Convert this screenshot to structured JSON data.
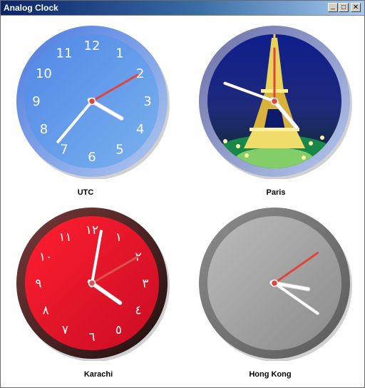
{
  "window": {
    "title": "Analog Clock",
    "buttons": {
      "minimize": "_",
      "maximize": "□",
      "close": "✕"
    }
  },
  "clocks": [
    {
      "city": "UTC",
      "face_style": "blue-gradient",
      "digits": [
        "12",
        "1",
        "2",
        "3",
        "4",
        "5",
        "6",
        "7",
        "8",
        "9",
        "10",
        "11"
      ],
      "colors": {
        "rim": "#4a7be0",
        "face_a": "#4f86e6",
        "face_b": "#7ab2ee",
        "digits": "#ffffff",
        "hands": "#ffffff",
        "second": "#e0443c"
      },
      "hands_angle": {
        "hour": 120,
        "minute": 220,
        "second": 60
      }
    },
    {
      "city": "Paris",
      "face_style": "eiffel-tower-night-photo",
      "digits": [],
      "colors": {
        "rim": "#6c6fa6",
        "face_a": "#0c1a6a",
        "face_b": "#17a54a",
        "hands": "#ffffff",
        "second": "#e0443c"
      },
      "hands_angle": {
        "hour": 140,
        "minute": 290,
        "second": 0
      }
    },
    {
      "city": "Karachi",
      "face_style": "red-arabic-numerals",
      "digits": [
        "١٢",
        "١",
        "٢",
        "٣",
        "٤",
        "٥",
        "٦",
        "٧",
        "٨",
        "٩",
        "١٠",
        "١١"
      ],
      "colors": {
        "rim": "#7a3a3a",
        "face_a": "#ff1f2f",
        "face_b": "#c90c24",
        "digits": "#ffffff",
        "hands": "#ffffff",
        "second": "#d9534f"
      },
      "hands_angle": {
        "hour": 125,
        "minute": 10,
        "second": 60
      }
    },
    {
      "city": "Hong Kong",
      "face_style": "grey-plain",
      "digits": [],
      "colors": {
        "rim": "#8c8c8c",
        "face_a": "#bcbcbc",
        "face_b": "#8a8a8a",
        "hands": "#ffffff",
        "second": "#e0443c"
      },
      "hands_angle": {
        "hour": 100,
        "minute": 125,
        "second": 55
      }
    }
  ]
}
